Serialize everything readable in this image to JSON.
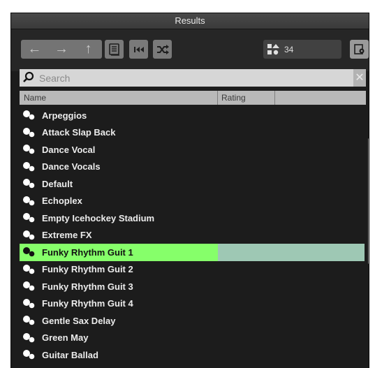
{
  "panel": {
    "title": "Results"
  },
  "toolbar": {
    "back_icon": "back-arrow-icon",
    "forward_icon": "forward-arrow-icon",
    "up_icon": "up-arrow-icon",
    "result_count": "34"
  },
  "search": {
    "placeholder": "Search",
    "value": ""
  },
  "columns": {
    "name": "Name",
    "rating": "Rating"
  },
  "results": [
    {
      "label": "Arpeggios"
    },
    {
      "label": "Attack Slap Back"
    },
    {
      "label": "Dance Vocal"
    },
    {
      "label": "Dance Vocals"
    },
    {
      "label": "Default"
    },
    {
      "label": "Echoplex"
    },
    {
      "label": "Empty Icehockey Stadium"
    },
    {
      "label": "Extreme FX"
    },
    {
      "label": "Funky Rhythm Guit 1",
      "selected": true
    },
    {
      "label": "Funky Rhythm Guit 2"
    },
    {
      "label": "Funky Rhythm Guit 3"
    },
    {
      "label": "Funky Rhythm Guit 4"
    },
    {
      "label": "Gentle Sax Delay"
    },
    {
      "label": "Green May"
    },
    {
      "label": "Guitar Ballad"
    }
  ],
  "colors": {
    "selection_name": "#86ff6a",
    "selection_rest": "#9ec8b4",
    "panel_bg": "#1c1c1c"
  }
}
